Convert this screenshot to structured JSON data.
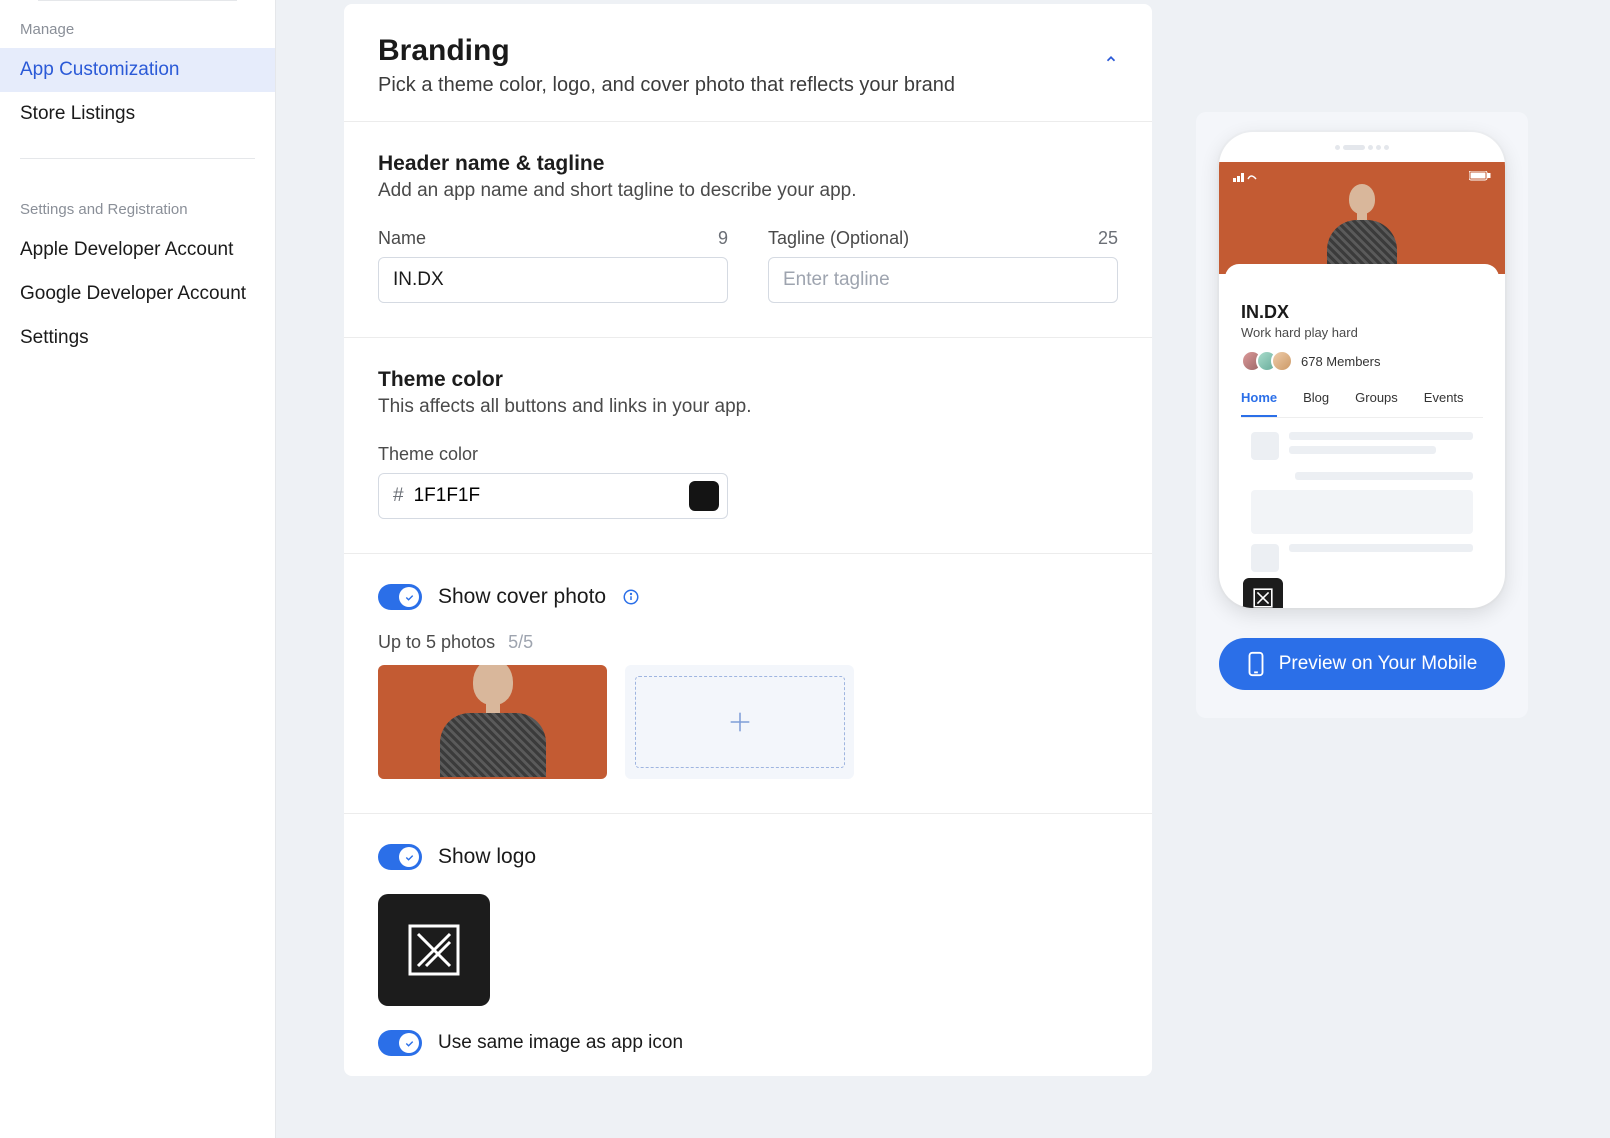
{
  "sidebar": {
    "manage_label": "Manage",
    "items_manage": [
      {
        "label": "App Customization",
        "active": true
      },
      {
        "label": "Store Listings",
        "active": false
      }
    ],
    "settings_label": "Settings and Registration",
    "items_settings": [
      {
        "label": "Apple Developer Account"
      },
      {
        "label": "Google Developer Account"
      },
      {
        "label": "Settings"
      }
    ]
  },
  "branding": {
    "title": "Branding",
    "subtitle": "Pick a theme color, logo, and cover photo that reflects your brand"
  },
  "header_section": {
    "title": "Header name & tagline",
    "subtitle": "Add an app name and short tagline to describe your app.",
    "name_label": "Name",
    "name_count": "9",
    "name_value": "IN.DX",
    "tagline_label": "Tagline (Optional)",
    "tagline_count": "25",
    "tagline_placeholder": "Enter tagline"
  },
  "theme_section": {
    "title": "Theme color",
    "subtitle": "This affects all buttons and links in your app.",
    "label": "Theme color",
    "hash": "#",
    "value": "1F1F1F",
    "swatch": "#141414"
  },
  "cover_section": {
    "toggle_label": "Show cover photo",
    "photos_label": "Up to 5 photos",
    "photos_count": "5/5"
  },
  "logo_section": {
    "toggle_label": "Show logo",
    "same_icon_label": "Use same image as app icon"
  },
  "preview": {
    "app_name": "IN.DX",
    "tagline": "Work hard play hard",
    "members": "678 Members",
    "tabs": [
      "Home",
      "Blog",
      "Groups",
      "Events"
    ],
    "button_label": "Preview on Your Mobile"
  },
  "colors": {
    "accent": "#2b6fe8",
    "cover": "#c35b33"
  }
}
